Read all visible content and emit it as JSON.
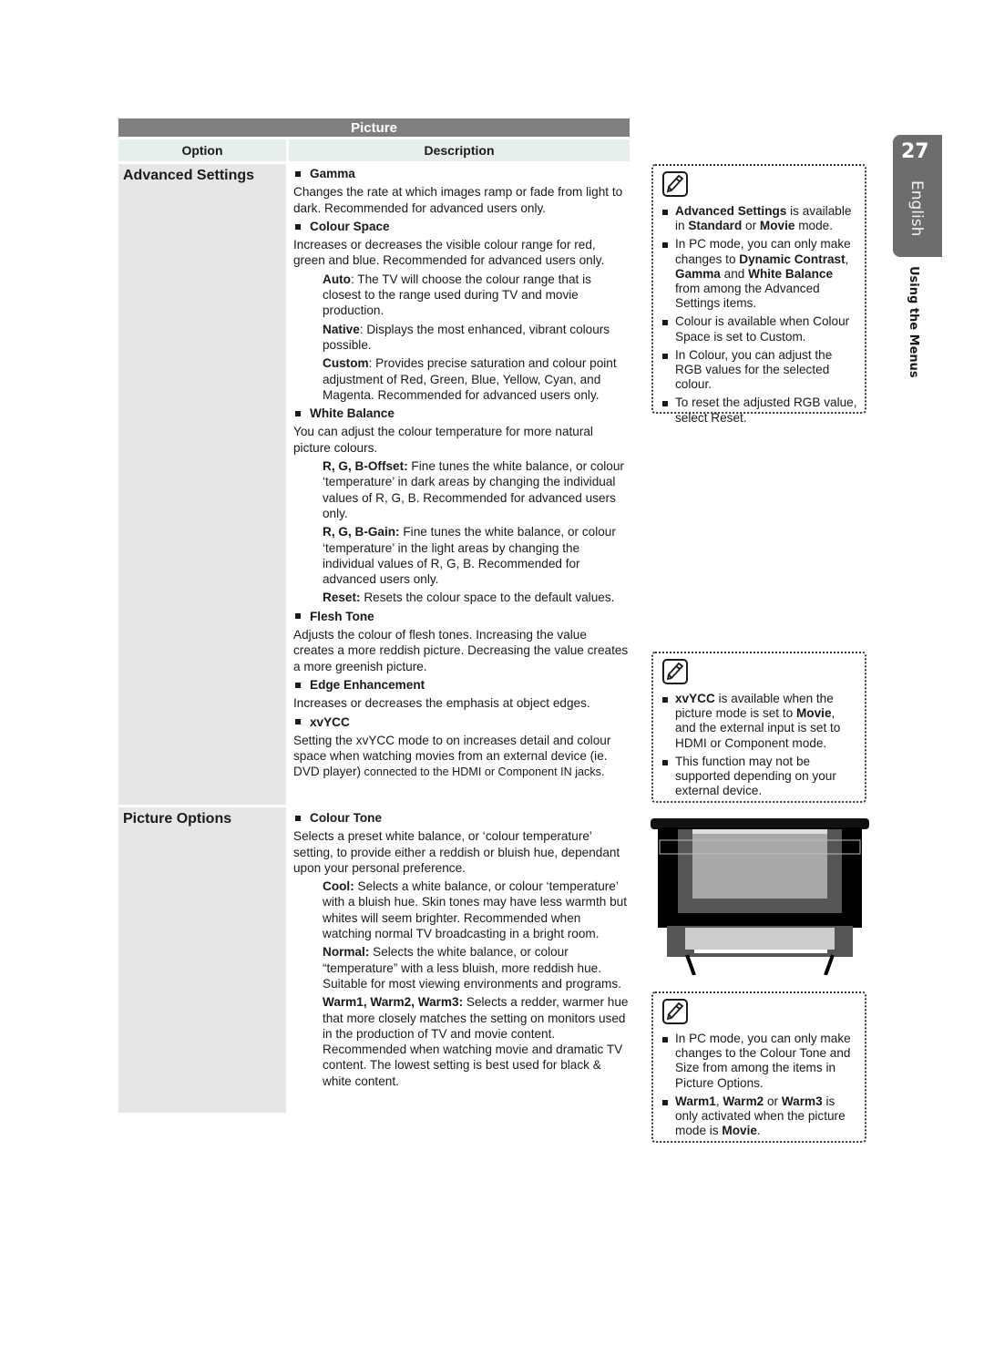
{
  "table": {
    "title": "Picture",
    "headers": {
      "option": "Option",
      "description": "Description"
    }
  },
  "options": [
    {
      "label": "Advanced Settings",
      "items": [
        {
          "title": "Gamma",
          "text": "Changes the rate at which images ramp or fade from light to dark. Recommended for advanced users only.",
          "subs": []
        },
        {
          "title": "Colour Space",
          "text": "Increases or decreases the visible colour range for red, green and blue. Recommended for advanced users only.",
          "subs": [
            {
              "term": "Auto",
              "sep": ": ",
              "text": "The TV will choose the colour range that is closest to the range used during TV and movie production."
            },
            {
              "term": "Native",
              "sep": ": ",
              "text": "Displays the most enhanced, vibrant colours possible."
            },
            {
              "term": "Custom",
              "sep": ": ",
              "text": "Provides precise saturation and colour point adjustment of Red, Green, Blue, Yellow, Cyan, and Magenta. Recommended for advanced users only."
            }
          ]
        },
        {
          "title": "White Balance",
          "text": "You can adjust the colour temperature for more natural picture colours.",
          "subs": [
            {
              "term": "R, G, B-Offset:",
              "sep": " ",
              "text": "Fine tunes the white balance, or colour ‘temperature’ in dark areas by changing the individual values of R, G, B. Recommended for advanced users only."
            },
            {
              "term": "R, G, B-Gain:",
              "sep": " ",
              "text": "Fine tunes the white balance, or colour ‘temperature’ in the light areas by changing the individual values of R, G, B.  Recommended for advanced users only."
            },
            {
              "term": "Reset:",
              "sep": " ",
              "text": "Resets the colour space to the default values."
            }
          ]
        },
        {
          "title": "Flesh Tone",
          "text": "Adjusts the colour of flesh tones. Increasing the value creates a more reddish picture. Decreasing the value creates a more greenish picture.",
          "subs": []
        },
        {
          "title": "Edge Enhancement",
          "text": "Increases or decreases the emphasis at object edges.",
          "subs": []
        },
        {
          "title": "xvYCC",
          "text": "Setting the xvYCC mode to on increases detail and colour space when watching movies from an external device (ie. DVD player)",
          "text_small": " connected to the HDMI or Component IN jacks.",
          "subs": []
        }
      ]
    },
    {
      "label": "Picture Options",
      "items": [
        {
          "title": "Colour Tone",
          "text": "Selects a preset white balance, or ‘colour temperature’ setting, to provide either a reddish or bluish hue, dependant upon your personal preference.",
          "subs": [
            {
              "term": "Cool:",
              "sep": " ",
              "text": "Selects a white balance, or colour ‘temperature’ with a bluish hue. Skin tones may have less warmth but whites will seem brighter. Recommended when watching normal TV broadcasting in a bright room."
            },
            {
              "term": "Normal:",
              "sep": " ",
              "text": "Selects the white balance, or colour “temperature” with a less bluish, more reddish hue. Suitable for most viewing environments and programs."
            },
            {
              "term": "Warm1, Warm2, Warm3:",
              "sep": " ",
              "text": "Selects a redder, warmer hue that more closely matches the setting on monitors used in the production of TV and movie content. Recommended when watching movie and dramatic TV content. The lowest setting is best used for black & white content."
            }
          ]
        }
      ]
    }
  ],
  "notes": [
    {
      "icon": "note-pencil-icon",
      "items": [
        [
          {
            "b": "Advanced Settings"
          },
          {
            "t": " is available in "
          },
          {
            "b": "Standard"
          },
          {
            "t": " or "
          },
          {
            "b": "Movie"
          },
          {
            "t": " mode."
          }
        ],
        [
          {
            "t": "In PC mode, you can only make changes to "
          },
          {
            "b": "Dynamic Contrast"
          },
          {
            "t": ", "
          },
          {
            "b": "Gamma"
          },
          {
            "t": " and "
          },
          {
            "b": "White Balance"
          },
          {
            "t": " from among the Advanced Settings items."
          }
        ],
        [
          {
            "t": "Colour is available when Colour Space is set to Custom."
          }
        ],
        [
          {
            "t": "In Colour, you can adjust the RGB values for the selected colour."
          }
        ],
        [
          {
            "t": "To reset the adjusted RGB value, select Reset."
          }
        ]
      ]
    },
    {
      "icon": "note-pencil-icon",
      "items": [
        [
          {
            "b": "xvYCC"
          },
          {
            "t": " is available when the picture mode is set to "
          },
          {
            "b": "Movie"
          },
          {
            "t": ", and the external input is set to HDMI or Component mode."
          }
        ],
        [
          {
            "t": "This function may not be supported depending on your external device."
          }
        ]
      ]
    },
    {
      "icon": "note-pencil-icon",
      "items": [
        [
          {
            "t": "In PC mode, you can only make changes to the Colour Tone and Size from among the items in Picture Options."
          }
        ],
        [
          {
            "b": "Warm1"
          },
          {
            "t": ", "
          },
          {
            "b": "Warm2"
          },
          {
            "t": " or "
          },
          {
            "b": "Warm3"
          },
          {
            "t": " is only activated when the picture mode is "
          },
          {
            "b": "Movie"
          },
          {
            "t": "."
          }
        ]
      ]
    }
  ],
  "page_tab": {
    "number": "27",
    "language": "English",
    "section": "Using the Menus"
  },
  "image": {
    "semantic": "tv-menu-screenshot-placeholder"
  }
}
